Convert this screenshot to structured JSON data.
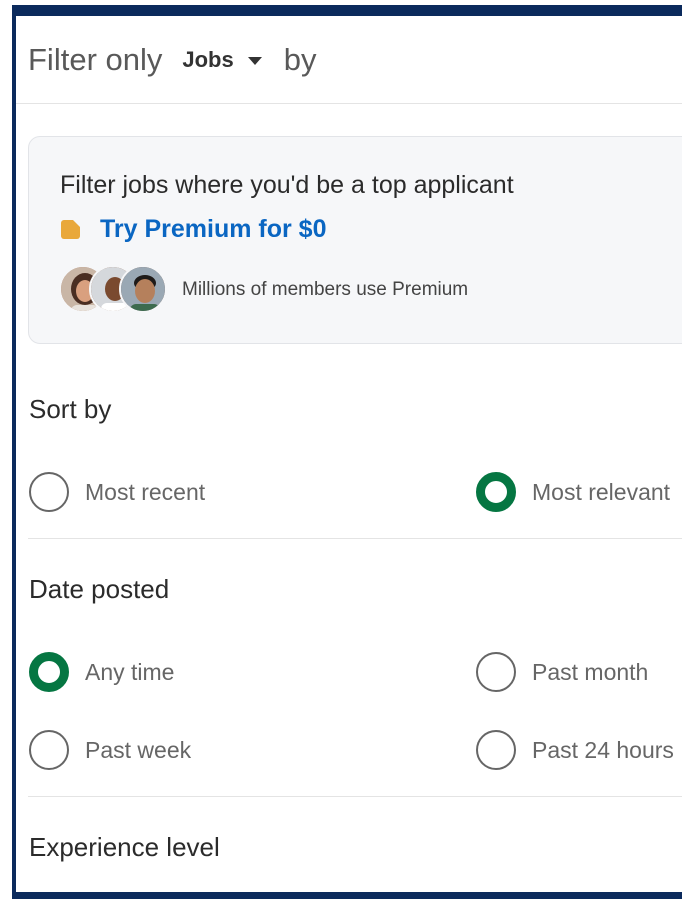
{
  "header": {
    "prefix": "Filter only",
    "dropdown_value": "Jobs",
    "suffix": "by"
  },
  "premium": {
    "title": "Filter jobs where you'd be a top applicant",
    "cta": "Try Premium for $0",
    "members_text": "Millions of members use Premium"
  },
  "sort_by": {
    "title": "Sort by",
    "options": [
      {
        "label": "Most recent",
        "selected": false
      },
      {
        "label": "Most relevant",
        "selected": true
      }
    ]
  },
  "date_posted": {
    "title": "Date posted",
    "options": [
      {
        "label": "Any time",
        "selected": true
      },
      {
        "label": "Past month",
        "selected": false
      },
      {
        "label": "Past week",
        "selected": false
      },
      {
        "label": "Past 24 hours",
        "selected": false
      }
    ]
  },
  "experience_level": {
    "title": "Experience level"
  },
  "colors": {
    "frame": "#0b2a5c",
    "accent_green": "#057642",
    "link_blue": "#0a66c2",
    "premium_gold": "#e9a83b"
  }
}
